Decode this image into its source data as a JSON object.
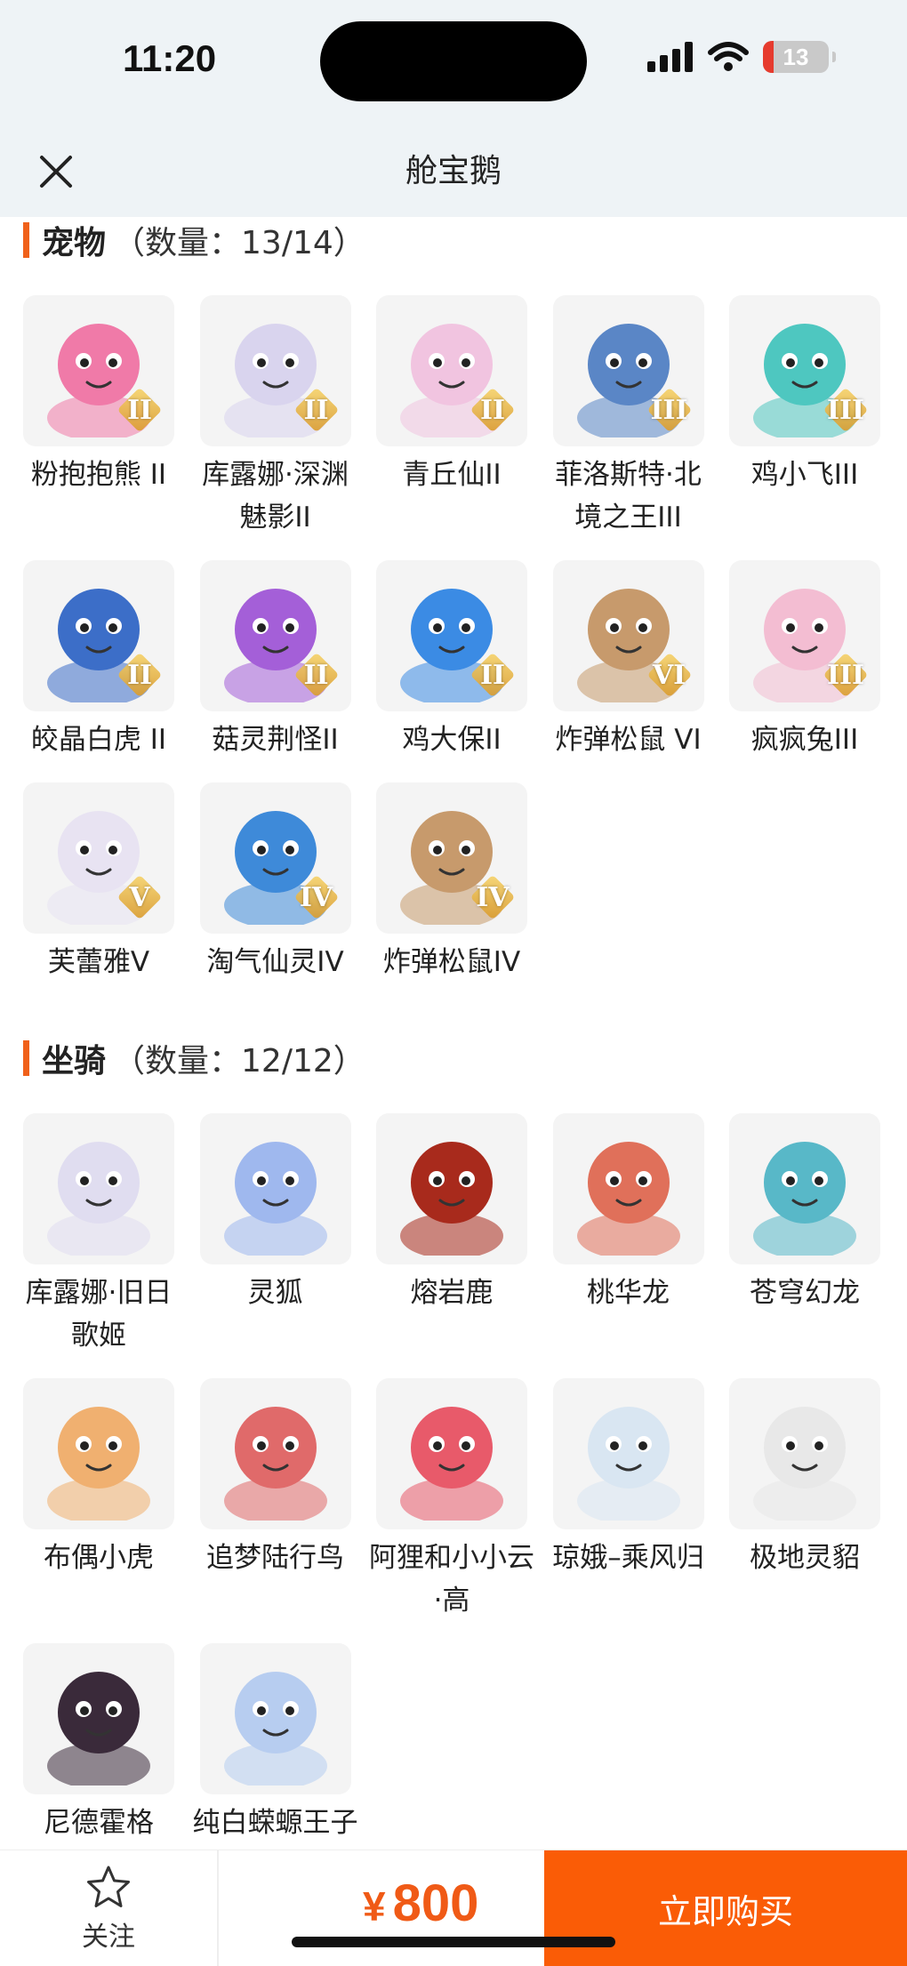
{
  "status_bar": {
    "time": "11:20",
    "battery": "13"
  },
  "header": {
    "title": "舱宝鹅"
  },
  "pets": {
    "title": "宠物",
    "count": "（数量：13/14）",
    "items": [
      {
        "name": "粉抱抱熊 II",
        "tier": "II",
        "color": "#f07aa8"
      },
      {
        "name": "库露娜·深渊魅影II",
        "tier": "II",
        "color": "#d9d4ee"
      },
      {
        "name": "青丘仙II",
        "tier": "II",
        "color": "#f1c4e0"
      },
      {
        "name": "菲洛斯特·北境之王III",
        "tier": "III",
        "color": "#5a86c6"
      },
      {
        "name": "鸡小飞III",
        "tier": "III",
        "color": "#4ec7c0"
      },
      {
        "name": "皎晶白虎 II",
        "tier": "II",
        "color": "#3c6ec8"
      },
      {
        "name": "菇灵荆怪II",
        "tier": "II",
        "color": "#a45fd8"
      },
      {
        "name": "鸡大保II",
        "tier": "II",
        "color": "#3b8be4"
      },
      {
        "name": "炸弹松鼠 VI",
        "tier": "VI",
        "color": "#c79a6c"
      },
      {
        "name": "疯疯兔III",
        "tier": "III",
        "color": "#f3bdd2"
      },
      {
        "name": "芙蕾雅V",
        "tier": "V",
        "color": "#e8e3f2"
      },
      {
        "name": "淘气仙灵IV",
        "tier": "IV",
        "color": "#3e8ad9"
      },
      {
        "name": "炸弹松鼠IV",
        "tier": "IV",
        "color": "#c79a6c"
      }
    ]
  },
  "mounts": {
    "title": "坐骑",
    "count": "（数量：12/12）",
    "items": [
      {
        "name": "库露娜·旧日歌姬",
        "color": "#e0ddf0"
      },
      {
        "name": "灵狐",
        "color": "#9fb8ee"
      },
      {
        "name": "熔岩鹿",
        "color": "#a82a1c"
      },
      {
        "name": "桃华龙",
        "color": "#e0705a"
      },
      {
        "name": "苍穹幻龙",
        "color": "#58b8c8"
      },
      {
        "name": "布偶小虎",
        "color": "#f0b070"
      },
      {
        "name": "追梦陆行鸟",
        "color": "#e06a6a"
      },
      {
        "name": "阿狸和小小云·高",
        "color": "#e85a6a"
      },
      {
        "name": "琼娥–乘风归",
        "color": "#d9e6f2"
      },
      {
        "name": "极地灵貂",
        "color": "#e8e8e8"
      },
      {
        "name": "尼德霍格",
        "color": "#3a2a3a"
      },
      {
        "name": "纯白蝾螈王子",
        "color": "#b7cdf0"
      }
    ]
  },
  "bottom_bar": {
    "follow_label": "关注",
    "currency": "¥",
    "price": "800",
    "buy_label": "立即购买"
  },
  "colors": {
    "accent": "#f0611a",
    "buy": "#fa5c06",
    "header_bg": "#eef3f6"
  },
  "icons": {
    "close": "close-icon",
    "star": "star-icon",
    "signal": "signal-icon",
    "wifi": "wifi-icon"
  }
}
